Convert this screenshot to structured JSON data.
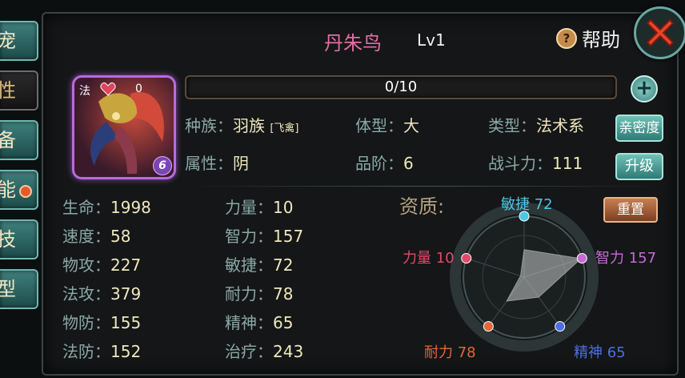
{
  "tabs": [
    {
      "label": "宠",
      "active": false,
      "dot": false
    },
    {
      "label": "性",
      "active": true,
      "dot": false
    },
    {
      "label": "备",
      "active": false,
      "dot": false
    },
    {
      "label": "能",
      "active": false,
      "dot": true
    },
    {
      "label": "技",
      "active": false,
      "dot": false
    },
    {
      "label": "型",
      "active": false,
      "dot": false
    }
  ],
  "header": {
    "name": "丹朱鸟",
    "level": "Lv1",
    "help": "帮助"
  },
  "portrait": {
    "tag": "法",
    "count": "0",
    "grade": "6"
  },
  "exp": {
    "text": "0/10",
    "progress": 0
  },
  "info": {
    "race_label": "种族：",
    "race": "羽族",
    "race_sub": "[飞禽]",
    "size_label": "体型：",
    "size": "大",
    "type_label": "类型：",
    "type": "法术系",
    "attr_label": "属性：",
    "attr": "阴",
    "rank_label": "品阶：",
    "rank": "6",
    "power_label": "战斗力：",
    "power": "111"
  },
  "buttons": {
    "intimacy": "亲密度",
    "upgrade": "升级",
    "reset": "重置"
  },
  "stats_left": [
    {
      "label": "生命：",
      "value": "1998"
    },
    {
      "label": "速度：",
      "value": "58"
    },
    {
      "label": "物攻：",
      "value": "227"
    },
    {
      "label": "法攻：",
      "value": "379"
    },
    {
      "label": "物防：",
      "value": "155"
    },
    {
      "label": "法防：",
      "value": "152"
    }
  ],
  "stats_right": [
    {
      "label": "力量：",
      "value": "10"
    },
    {
      "label": "智力：",
      "value": "157"
    },
    {
      "label": "敏捷：",
      "value": "72"
    },
    {
      "label": "耐力：",
      "value": "78"
    },
    {
      "label": "精神：",
      "value": "65"
    },
    {
      "label": "治疗：",
      "value": "243"
    }
  ],
  "aptitude_title": "资质:",
  "chart_data": {
    "type": "radar",
    "axes": [
      {
        "label": "敏捷 72",
        "value": 72,
        "color": "#4ec6e8"
      },
      {
        "label": "智力 157",
        "value": 157,
        "color": "#c66ad8"
      },
      {
        "label": "精神 65",
        "value": 65,
        "color": "#4d6fe0"
      },
      {
        "label": "耐力 78",
        "value": 78,
        "color": "#e2683a"
      },
      {
        "label": "力量 10",
        "value": 10,
        "color": "#e24a6a"
      }
    ],
    "max": 160
  }
}
